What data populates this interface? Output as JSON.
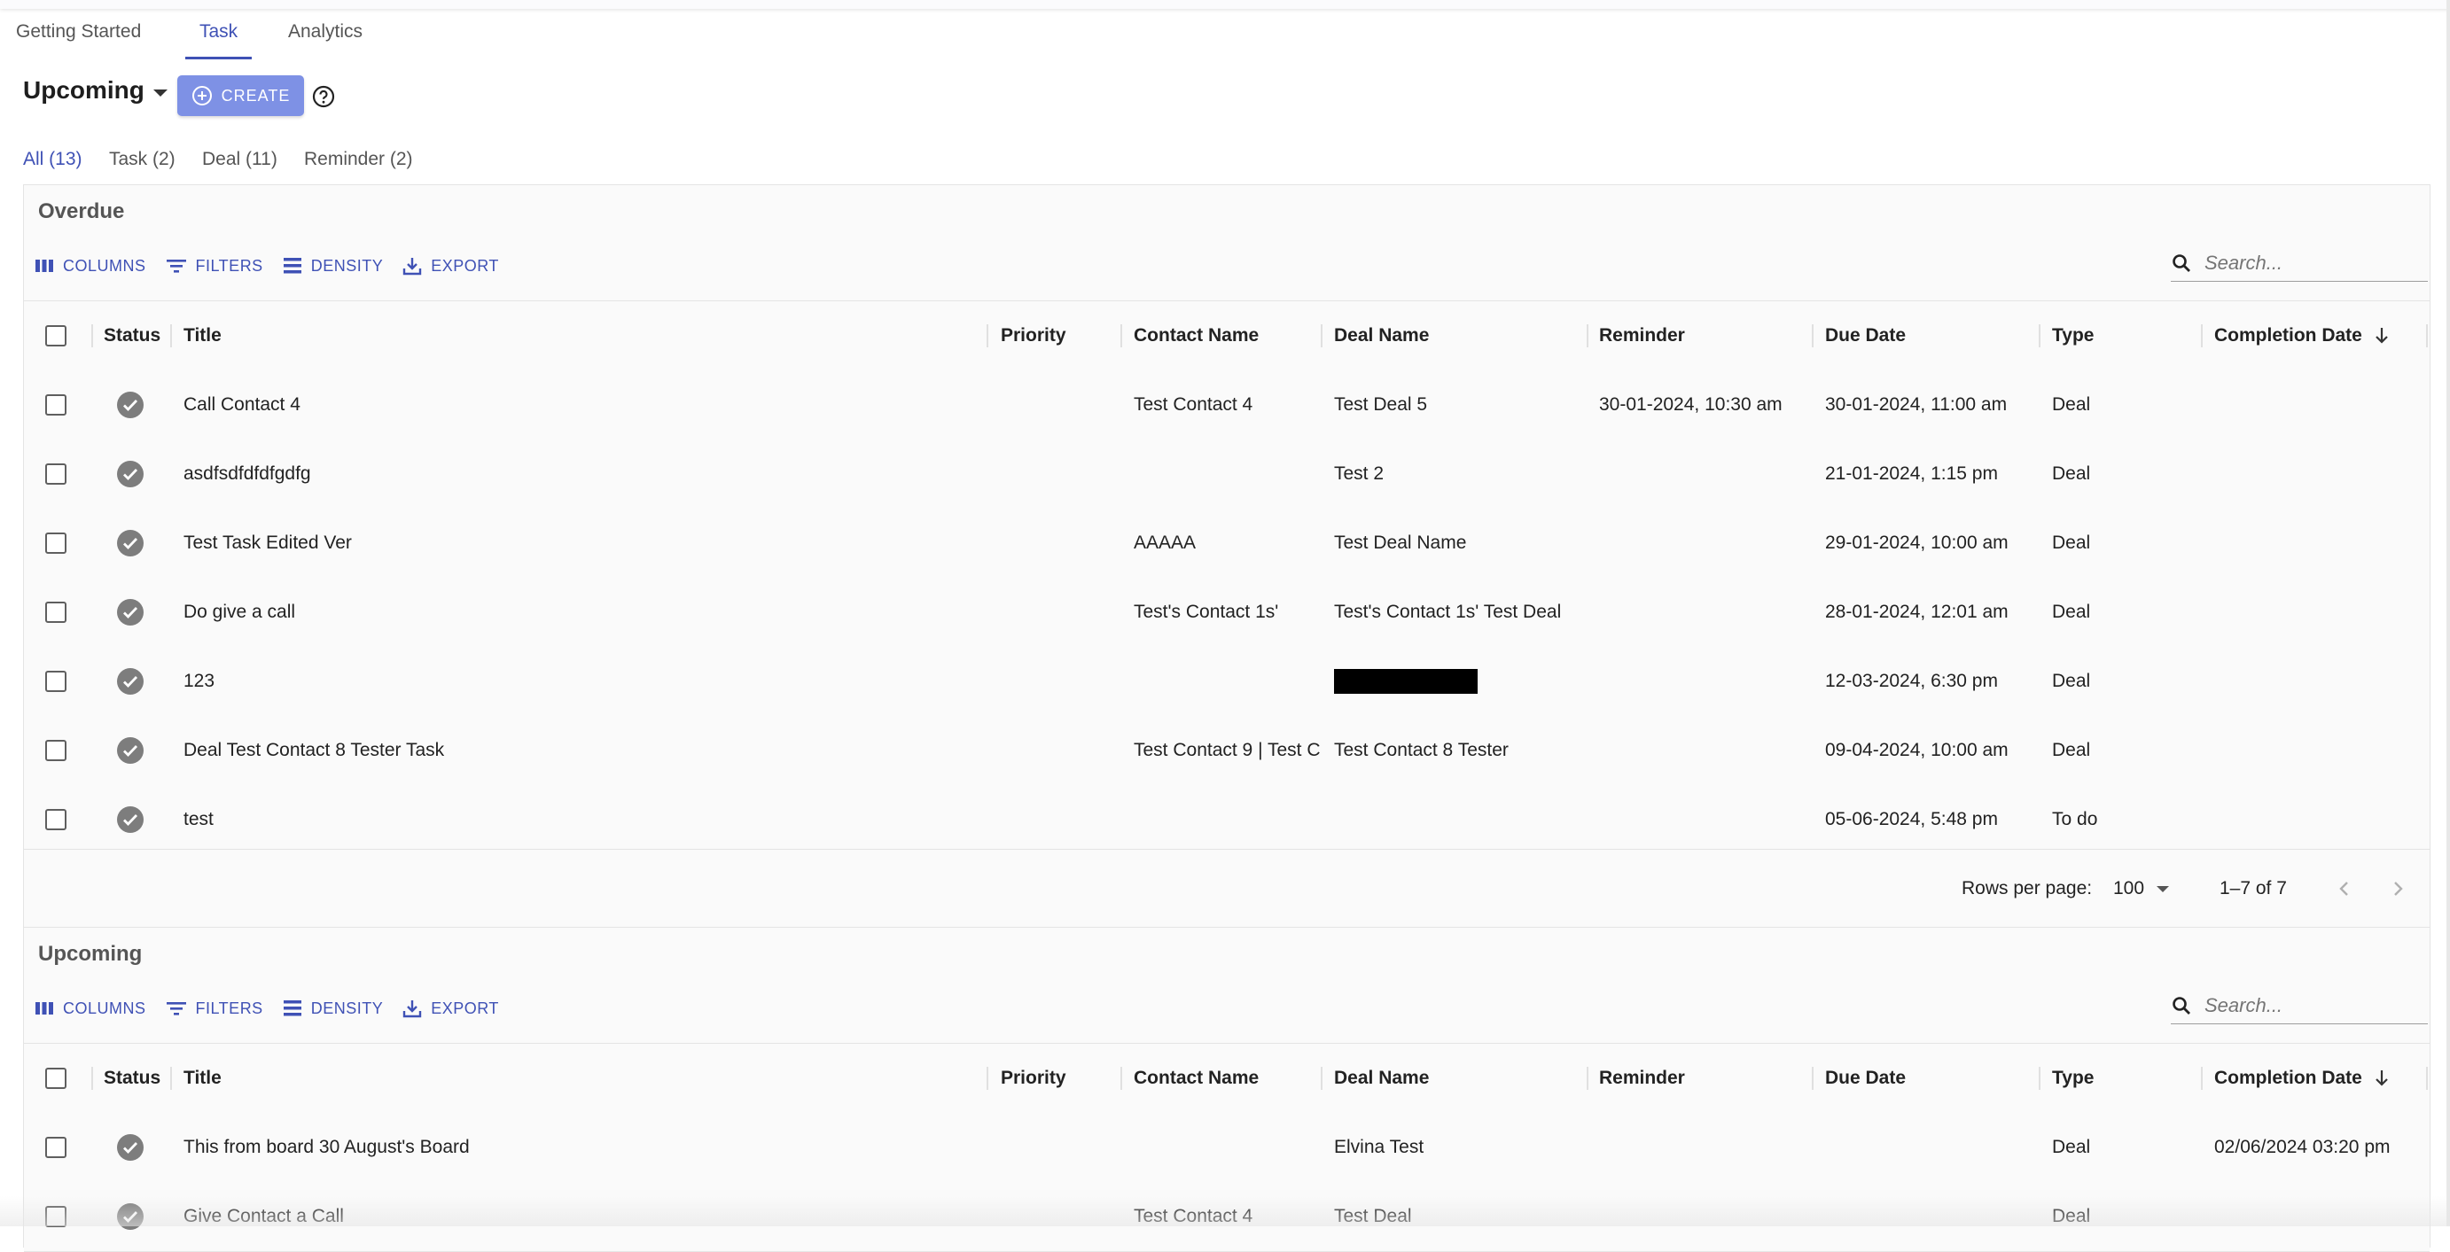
{
  "top_tabs": [
    {
      "label": "Getting Started",
      "active": false
    },
    {
      "label": "Task",
      "active": true
    },
    {
      "label": "Analytics",
      "active": false
    }
  ],
  "view": {
    "title": "Upcoming",
    "create_label": "CREATE"
  },
  "sub_tabs": [
    {
      "label": "All (13)",
      "active": true
    },
    {
      "label": "Task (2)",
      "active": false
    },
    {
      "label": "Deal (11)",
      "active": false
    },
    {
      "label": "Reminder (2)",
      "active": false
    }
  ],
  "toolbar": {
    "columns": "COLUMNS",
    "filters": "FILTERS",
    "density": "DENSITY",
    "export": "EXPORT",
    "search_placeholder": "Search..."
  },
  "columns": [
    "Status",
    "Title",
    "Priority",
    "Contact Name",
    "Deal Name",
    "Reminder",
    "Due Date",
    "Type",
    "Completion Date"
  ],
  "overdue": {
    "title": "Overdue",
    "rows": [
      {
        "title": "Call Contact 4",
        "priority": "",
        "contact": "Test Contact 4",
        "deal": "Test Deal 5",
        "reminder": "30-01-2024, 10:30 am",
        "due": "30-01-2024, 11:00 am",
        "type": "Deal",
        "completion": ""
      },
      {
        "title": "asdfsdfdfdfgdfg",
        "priority": "",
        "contact": "",
        "deal": "Test 2",
        "reminder": "",
        "due": "21-01-2024, 1:15 pm",
        "type": "Deal",
        "completion": ""
      },
      {
        "title": "Test Task Edited Ver",
        "priority": "",
        "contact": "AAAAA",
        "deal": "Test Deal Name",
        "reminder": "",
        "due": "29-01-2024, 10:00 am",
        "type": "Deal",
        "completion": ""
      },
      {
        "title": "Do give a call",
        "priority": "",
        "contact": "Test's Contact 1s'",
        "deal": "Test's Contact 1s' Test Deal",
        "reminder": "",
        "due": "28-01-2024, 12:01 am",
        "type": "Deal",
        "completion": ""
      },
      {
        "title": "123",
        "priority": "",
        "contact": "",
        "deal": "",
        "reminder": "",
        "due": "12-03-2024, 6:30 pm",
        "type": "Deal",
        "completion": ""
      },
      {
        "title": "Deal Test Contact 8 Tester Task",
        "priority": "",
        "contact": "Test Contact 9 | Test C",
        "deal": "Test Contact 8 Tester",
        "reminder": "",
        "due": "09-04-2024, 10:00 am",
        "type": "Deal",
        "completion": ""
      },
      {
        "title": "test",
        "priority": "",
        "contact": "",
        "deal": "",
        "reminder": "",
        "due": "05-06-2024, 5:48 pm",
        "type": "To do",
        "completion": ""
      }
    ],
    "footer": {
      "rows_per_page_label": "Rows per page:",
      "rows_per_page": "100",
      "range": "1–7 of 7"
    }
  },
  "upcoming": {
    "title": "Upcoming",
    "rows": [
      {
        "title": "This from board 30 August's Board",
        "priority": "",
        "contact": "",
        "deal": "Elvina Test",
        "reminder": "",
        "due": "",
        "type": "Deal",
        "completion": "02/06/2024 03:20 pm"
      },
      {
        "title": "Give Contact a Call",
        "priority": "",
        "contact": "Test Contact 4",
        "deal": "Test Deal",
        "reminder": "",
        "due": "",
        "type": "Deal",
        "completion": ""
      }
    ]
  }
}
